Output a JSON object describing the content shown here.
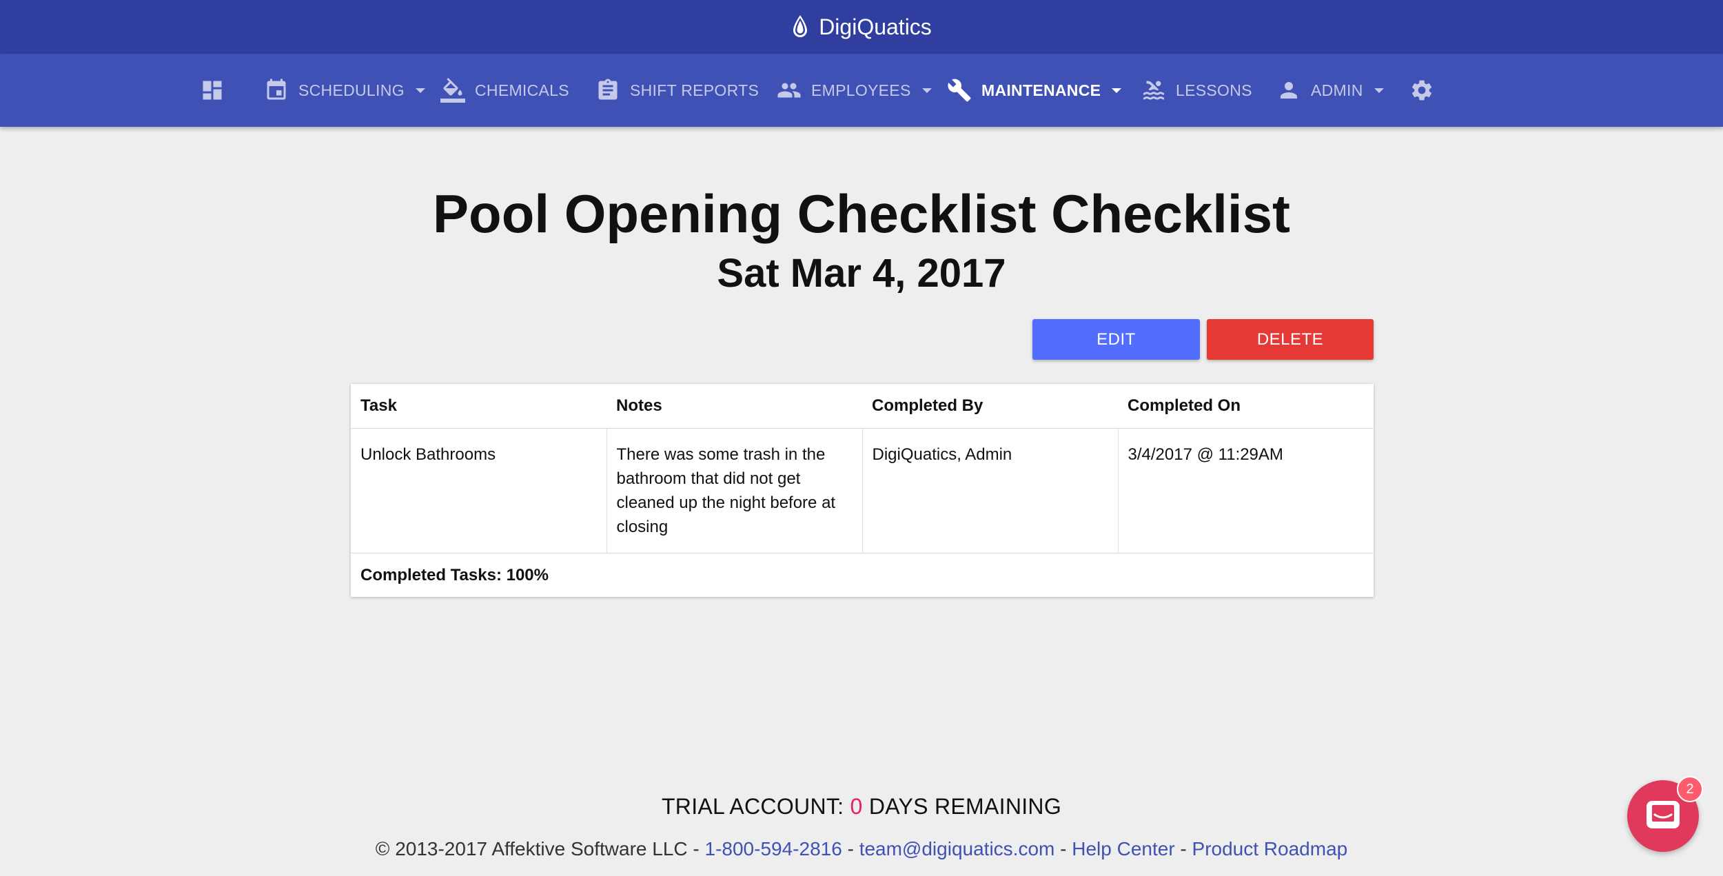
{
  "app": {
    "brand": "DigiQuatics"
  },
  "nav": {
    "items": [
      {
        "key": "dashboard",
        "label": "",
        "icon": "dashboard-icon"
      },
      {
        "key": "scheduling",
        "label": "SCHEDULING",
        "icon": "calendar-icon",
        "dropdown": true
      },
      {
        "key": "chemicals",
        "label": "CHEMICALS",
        "icon": "paint-bucket-icon"
      },
      {
        "key": "shift-reports",
        "label": "SHIFT REPORTS",
        "icon": "clipboard-icon"
      },
      {
        "key": "employees",
        "label": "EMPLOYEES",
        "icon": "people-icon",
        "dropdown": true
      },
      {
        "key": "maintenance",
        "label": "MAINTENANCE",
        "icon": "wrench-icon",
        "dropdown": true,
        "active": true
      },
      {
        "key": "lessons",
        "label": "LESSONS",
        "icon": "swimmer-icon"
      },
      {
        "key": "admin",
        "label": "ADMIN",
        "icon": "person-icon",
        "dropdown": true
      },
      {
        "key": "settings",
        "label": "",
        "icon": "gear-icon"
      }
    ]
  },
  "page": {
    "title": "Pool Opening Checklist Checklist",
    "date": "Sat Mar 4, 2017"
  },
  "actions": {
    "edit_label": "EDIT",
    "delete_label": "DELETE"
  },
  "table": {
    "headers": [
      "Task",
      "Notes",
      "Completed By",
      "Completed On"
    ],
    "rows": [
      {
        "task": "Unlock Bathrooms",
        "notes": "There was some trash in the bathroom that did not get cleaned up the night before at closing",
        "completed_by": "DigiQuatics, Admin",
        "completed_on": "3/4/2017 @ 11:29AM"
      }
    ],
    "summary": "Completed Tasks: 100%"
  },
  "trial": {
    "prefix": "TRIAL ACCOUNT: ",
    "days": "0",
    "suffix": " DAYS REMAINING"
  },
  "footer": {
    "copyright": "© 2013-2017 Affektive Software LLC - ",
    "phone": "1-800-594-2816",
    "email": "team@digiquatics.com",
    "help": "Help Center",
    "roadmap": "Product Roadmap",
    "separator": " - "
  },
  "chat": {
    "badge": "2"
  },
  "colors": {
    "topbar": "#303f9f",
    "navbar": "#3f51b5",
    "edit": "#536dfe",
    "delete": "#e53935",
    "trial_count": "#e91e63",
    "chat": "#e0395c"
  }
}
